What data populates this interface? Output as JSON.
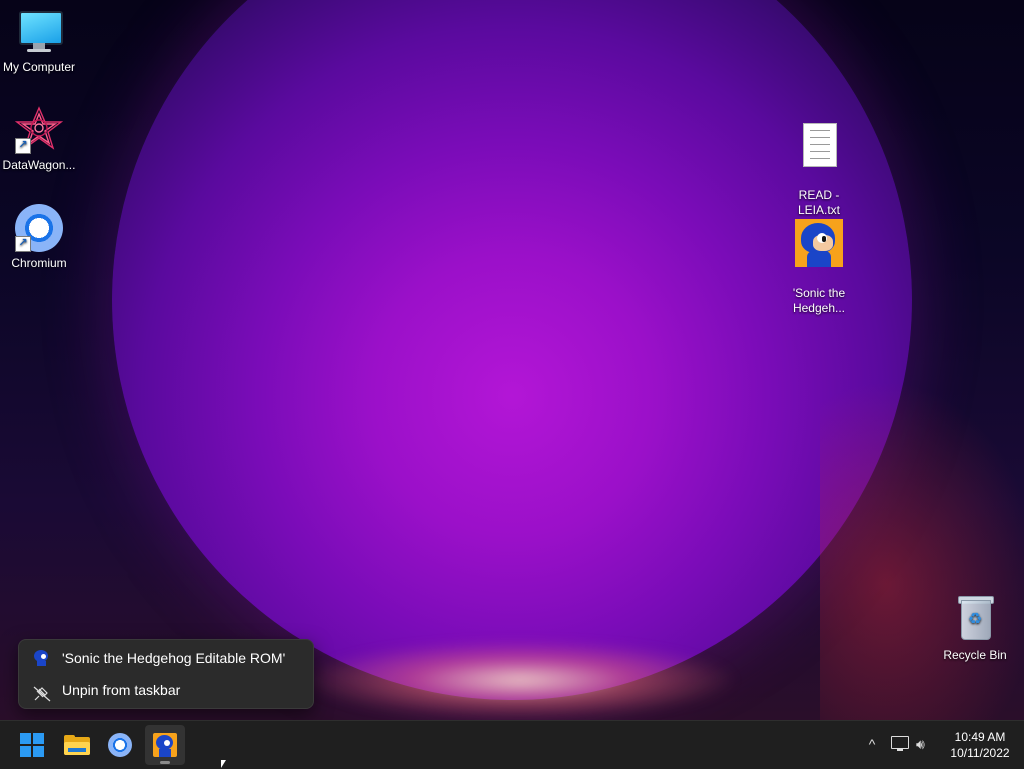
{
  "desktop": {
    "icons": [
      {
        "label": "My Computer",
        "icon": "monitor-icon"
      },
      {
        "label": "DataWagon...",
        "icon": "datawagon-icon"
      },
      {
        "label": "Chromium",
        "icon": "chromium-icon"
      },
      {
        "label": "READ -\nLEIA.txt",
        "icon": "text-file-icon"
      },
      {
        "label": "'Sonic the\nHedgeh...",
        "icon": "sonic-icon"
      },
      {
        "label": "Recycle Bin",
        "icon": "recycle-bin-icon"
      }
    ]
  },
  "jumplist": {
    "items": [
      {
        "label": "'Sonic the Hedgehog Editable ROM'",
        "icon": "sonic-icon"
      },
      {
        "label": "Unpin from taskbar",
        "icon": "unpin-icon"
      }
    ]
  },
  "taskbar": {
    "apps": [
      {
        "name": "Start",
        "icon": "windows-start-icon"
      },
      {
        "name": "File Explorer",
        "icon": "folder-icon"
      },
      {
        "name": "Chromium",
        "icon": "chromium-icon"
      },
      {
        "name": "'Sonic the Hedgehog Editable ROM'",
        "icon": "sonic-icon",
        "active": true
      }
    ],
    "tray": {
      "chevron": "^",
      "network_icon": "network-icon",
      "volume_icon": "volume-icon",
      "time": "10:49 AM",
      "date": "10/11/2022"
    }
  },
  "colors": {
    "accent": "#2b9af3",
    "taskbar_bg": "#1f1f1f",
    "menu_bg": "#2b2b2b"
  }
}
